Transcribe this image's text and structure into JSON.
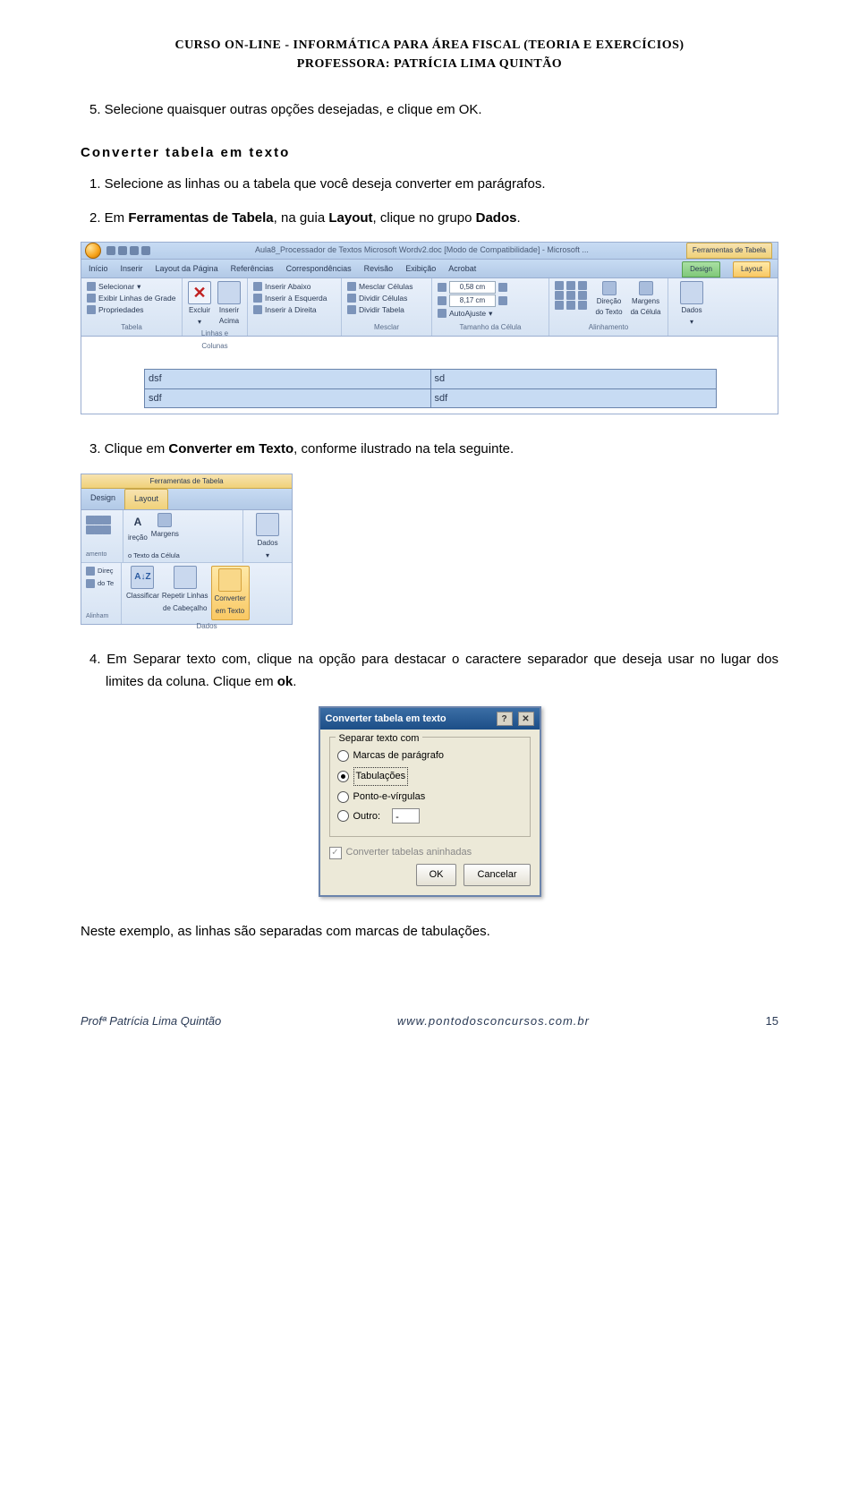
{
  "header": {
    "line1": "CURSO ON-LINE - INFORMÁTICA PARA ÁREA FISCAL (TEORIA E EXERCÍCIOS)",
    "line2": "PROFESSORA: PATRÍCIA LIMA QUINTÃO"
  },
  "step5": "5. Selecione quaisquer outras opções desejadas, e clique em OK.",
  "section_heading": "Converter tabela em texto",
  "step1": "1. Selecione as linhas ou a tabela que você deseja converter em parágrafos.",
  "step2_pre": "2. Em ",
  "step2_b1": "Ferramentas de Tabela",
  "step2_mid1": ", na guia ",
  "step2_b2": "Layout",
  "step2_mid2": ", clique no grupo ",
  "step2_b3": "Dados",
  "step2_end": ".",
  "step3_pre": "3. Clique em ",
  "step3_b1": "Converter em Texto",
  "step3_end": ", conforme ilustrado na tela seguinte.",
  "step4_pre": "4. Em Separar texto com, clique na opção para destacar o caractere separador que deseja usar no lugar dos limites da coluna. Clique em ",
  "step4_b1": "ok",
  "step4_end": ".",
  "closing": "Neste exemplo, as linhas são separadas com marcas de tabulações.",
  "ribbon1": {
    "doc_title": "Aula8_Processador de Textos Microsoft Wordv2.doc [Modo de Compatibilidade] - Microsoft ...",
    "context_label": "Ferramentas de Tabela",
    "tabs": [
      "Início",
      "Inserir",
      "Layout da Página",
      "Referências",
      "Correspondências",
      "Revisão",
      "Exibição",
      "Acrobat"
    ],
    "design": "Design",
    "layout": "Layout",
    "g_tabela": {
      "selecionar": "Selecionar",
      "grade": "Exibir Linhas de Grade",
      "prop": "Propriedades",
      "label": "Tabela"
    },
    "g_excluir": {
      "big": "Excluir"
    },
    "g_lc": {
      "acima": "Inserir Acima",
      "abaixo": "Inserir Abaixo",
      "esq": "Inserir à Esquerda",
      "dir": "Inserir à Direita",
      "label": "Linhas e Colunas"
    },
    "g_mesclar": {
      "mc": "Mesclar Células",
      "dc": "Dividir Células",
      "dt": "Dividir Tabela",
      "label": "Mesclar"
    },
    "g_tam": {
      "h": "0,58 cm",
      "w": "8,17 cm",
      "auto": "AutoAjuste",
      "label": "Tamanho da Célula"
    },
    "g_alin": {
      "dir": "Direção do Texto",
      "marg": "Margens da Célula",
      "label": "Alinhamento"
    },
    "g_dados": {
      "dados": "Dados",
      "label": ""
    },
    "cells": {
      "a1": "dsf",
      "b1": "sd",
      "a2": "sdf",
      "b2": "sdf"
    }
  },
  "ribbon2": {
    "context": "Ferramentas de Tabela",
    "design": "Design",
    "layout": "Layout",
    "top_labels": {
      "dir": "ireção",
      "marg": "Margens",
      "sub": "o Texto da Célula",
      "group": "amento",
      "dados": "Dados"
    },
    "bottom": {
      "g1a": "Direç",
      "g1b": "do Te",
      "g1lbl": "Alinham",
      "sort": "Classificar",
      "repeat1": "Repetir Linhas",
      "repeat2": "de Cabeçalho",
      "conv1": "Converter",
      "conv2": "em Texto",
      "label": "Dados"
    }
  },
  "dialog": {
    "title": "Converter tabela em texto",
    "group": "Separar texto com",
    "r1": "Marcas de parágrafo",
    "r2": "Tabulações",
    "r3": "Ponto-e-vírgulas",
    "r4": "Outro:",
    "other_val": "-",
    "chk": "Converter tabelas aninhadas",
    "ok": "OK",
    "cancel": "Cancelar"
  },
  "footer": {
    "left": "Profª Patrícia Lima Quintão",
    "center": "www.pontodosconcursos.com.br",
    "page": "15"
  }
}
